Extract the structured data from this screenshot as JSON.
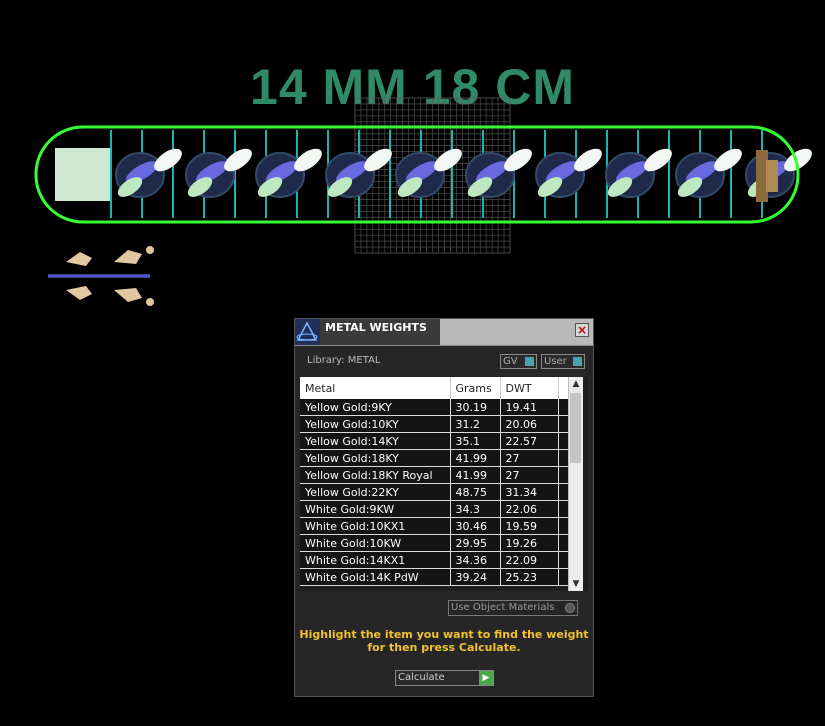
{
  "headline": "14 MM 18 CM",
  "dialog": {
    "title": "METAL WEIGHTS",
    "library_label": "Library: METAL",
    "gv_label": "GV",
    "user_label": "User",
    "columns": [
      "Metal",
      "Grams",
      "DWT"
    ],
    "rows": [
      [
        "Yellow Gold:9KY",
        "30.19",
        "19.41"
      ],
      [
        "Yellow Gold:10KY",
        "31.2",
        "20.06"
      ],
      [
        "Yellow Gold:14KY",
        "35.1",
        "22.57"
      ],
      [
        "Yellow Gold:18KY",
        "41.99",
        "27"
      ],
      [
        "Yellow Gold:18KY Royal",
        "41.99",
        "27"
      ],
      [
        "Yellow Gold:22KY",
        "48.75",
        "31.34"
      ],
      [
        "White Gold:9KW",
        "34.3",
        "22.06"
      ],
      [
        "White Gold:10KX1",
        "30.46",
        "19.59"
      ],
      [
        "White Gold:10KW",
        "29.95",
        "19.26"
      ],
      [
        "White Gold:14KX1",
        "34.36",
        "22.09"
      ],
      [
        "White Gold:14K PdW",
        "39.24",
        "25.23"
      ]
    ],
    "use_object_materials": "Use Object Materials",
    "hint": "Highlight the item you want to find the weight for then press Calculate.",
    "calculate_label": "Calculate"
  },
  "colors": {
    "accent_green": "#2f8a68",
    "hint_yellow": "#f2c230",
    "outline_green": "#33ff33"
  },
  "icons": [
    "app-logo-icon",
    "close-icon",
    "scroll-up-icon",
    "scroll-down-icon",
    "play-arrow-icon",
    "toggle-icon"
  ]
}
